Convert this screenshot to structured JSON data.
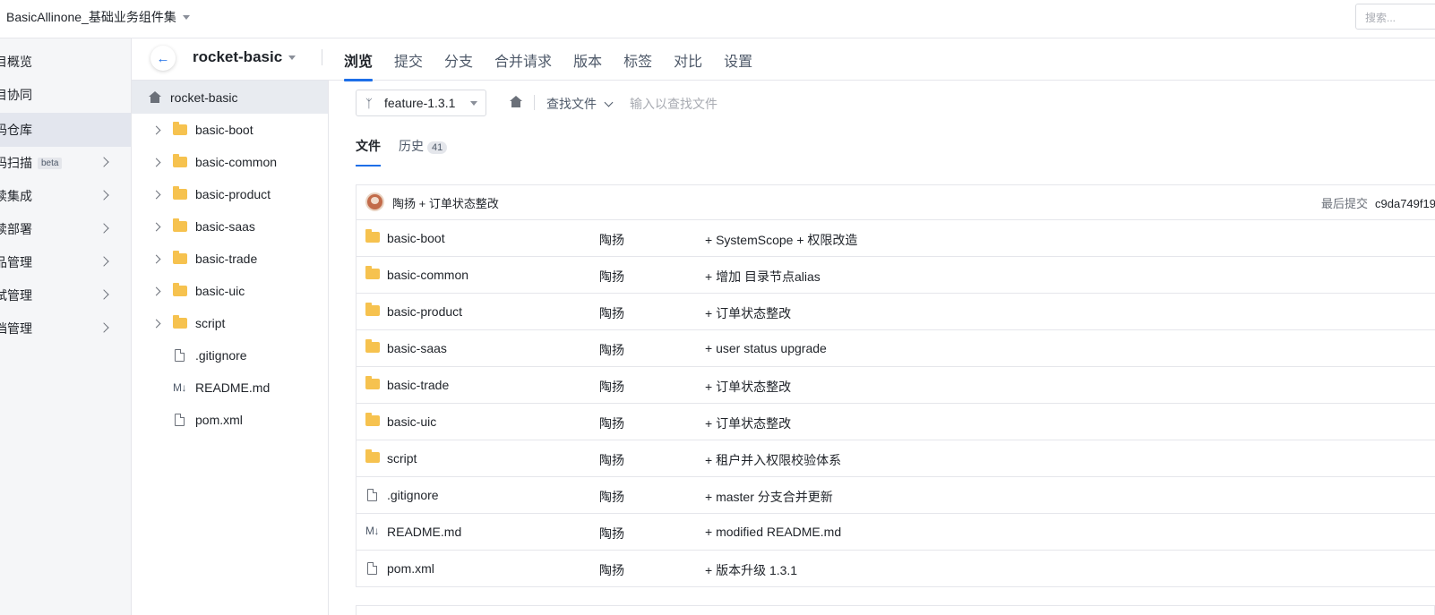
{
  "topbar": {
    "project_name": "BasicAllinone_基础业务组件集",
    "search_placeholder": "搜索..."
  },
  "leftnav": {
    "items": [
      {
        "label": "目概览",
        "has_chevron": false,
        "active": false
      },
      {
        "label": "目协同",
        "has_chevron": false,
        "active": false
      },
      {
        "label": "码仓库",
        "has_chevron": false,
        "active": true
      },
      {
        "label": "码扫描",
        "has_chevron": true,
        "active": false,
        "badge": "beta"
      },
      {
        "label": "续集成",
        "has_chevron": true,
        "active": false
      },
      {
        "label": "续部署",
        "has_chevron": true,
        "active": false
      },
      {
        "label": "品管理",
        "has_chevron": true,
        "active": false
      },
      {
        "label": "试管理",
        "has_chevron": true,
        "active": false
      },
      {
        "label": "档管理",
        "has_chevron": true,
        "active": false
      }
    ]
  },
  "repo": {
    "name": "rocket-basic",
    "tabs": [
      "浏览",
      "提交",
      "分支",
      "合并请求",
      "版本",
      "标签",
      "对比",
      "设置"
    ],
    "active_tab": "浏览"
  },
  "tree": {
    "root": "rocket-basic",
    "items": [
      {
        "name": "basic-boot",
        "type": "folder"
      },
      {
        "name": "basic-common",
        "type": "folder"
      },
      {
        "name": "basic-product",
        "type": "folder"
      },
      {
        "name": "basic-saas",
        "type": "folder"
      },
      {
        "name": "basic-trade",
        "type": "folder"
      },
      {
        "name": "basic-uic",
        "type": "folder"
      },
      {
        "name": "script",
        "type": "folder"
      },
      {
        "name": ".gitignore",
        "type": "file"
      },
      {
        "name": "README.md",
        "type": "markdown"
      },
      {
        "name": "pom.xml",
        "type": "file"
      }
    ]
  },
  "toolbar": {
    "branch": "feature-1.3.1",
    "find_file": "查找文件",
    "find_placeholder": "输入以查找文件"
  },
  "subtabs": {
    "files": "文件",
    "history": "历史",
    "history_count": "41"
  },
  "commit": {
    "author_message": "陶扬 + 订单状态整改",
    "last_commit_label": "最后提交",
    "hash": "c9da749f19"
  },
  "files": [
    {
      "name": "basic-boot",
      "type": "folder",
      "author": "陶扬",
      "message": "+ SystemScope + 权限改造"
    },
    {
      "name": "basic-common",
      "type": "folder",
      "author": "陶扬",
      "message": "+ 增加 目录节点alias"
    },
    {
      "name": "basic-product",
      "type": "folder",
      "author": "陶扬",
      "message": "+ 订单状态整改"
    },
    {
      "name": "basic-saas",
      "type": "folder",
      "author": "陶扬",
      "message": "+ user status upgrade"
    },
    {
      "name": "basic-trade",
      "type": "folder",
      "author": "陶扬",
      "message": "+ 订单状态整改"
    },
    {
      "name": "basic-uic",
      "type": "folder",
      "author": "陶扬",
      "message": "+ 订单状态整改"
    },
    {
      "name": "script",
      "type": "folder",
      "author": "陶扬",
      "message": "+ 租户并入权限校验体系"
    },
    {
      "name": ".gitignore",
      "type": "file",
      "author": "陶扬",
      "message": "+ master 分支合并更新"
    },
    {
      "name": "README.md",
      "type": "markdown",
      "author": "陶扬",
      "message": "+ modified README.md"
    },
    {
      "name": "pom.xml",
      "type": "file",
      "author": "陶扬",
      "message": "+ 版本升级 1.3.1"
    }
  ],
  "colors": {
    "accent": "#1e6fe8",
    "folder": "#f6c24f"
  }
}
